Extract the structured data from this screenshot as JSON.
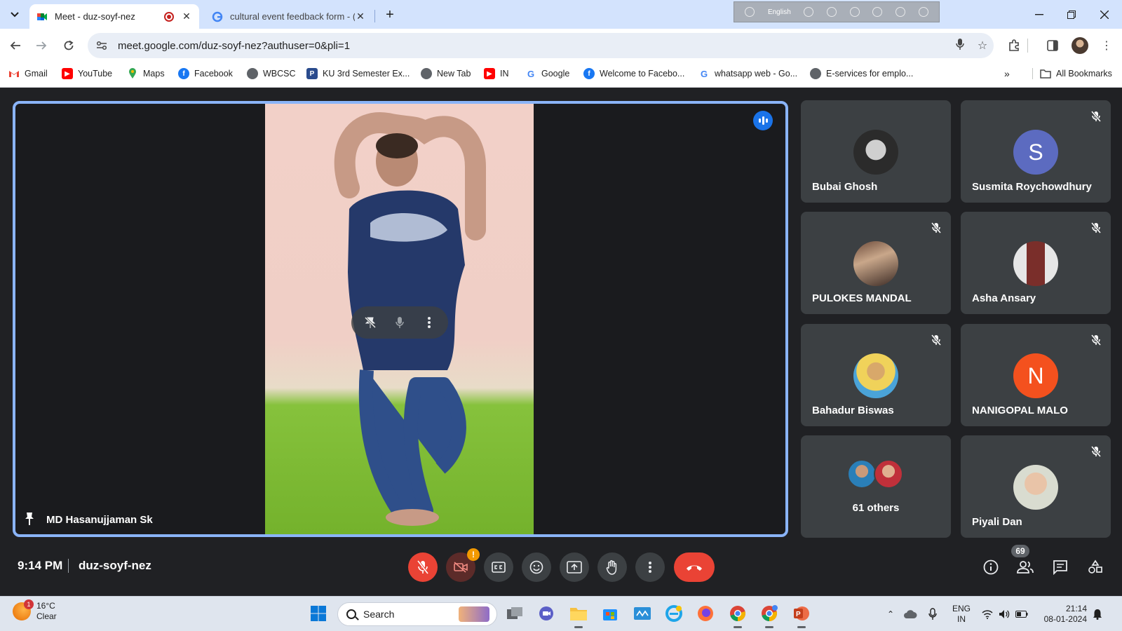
{
  "browser": {
    "tabs": [
      {
        "title": "Meet - duz-soyf-nez",
        "active": true,
        "favicon": "meet-icon",
        "recording": true
      },
      {
        "title": "cultural event feedback form - (",
        "active": false,
        "favicon": "google-icon"
      }
    ],
    "url": "meet.google.com/duz-soyf-nez?authuser=0&pli=1",
    "ime_language": "English",
    "bookmarks": [
      {
        "label": "Gmail",
        "icon": "gmail-icon"
      },
      {
        "label": "YouTube",
        "icon": "youtube-icon"
      },
      {
        "label": "Maps",
        "icon": "maps-icon"
      },
      {
        "label": "Facebook",
        "icon": "facebook-icon"
      },
      {
        "label": "WBCSC",
        "icon": "globe-icon"
      },
      {
        "label": "KU 3rd Semester Ex...",
        "icon": "ku-icon"
      },
      {
        "label": "New Tab",
        "icon": "globe-icon"
      },
      {
        "label": "IN",
        "icon": "youtube-icon"
      },
      {
        "label": "Google",
        "icon": "google-icon"
      },
      {
        "label": "Welcome to Facebo...",
        "icon": "facebook-icon"
      },
      {
        "label": "whatsapp web - Go...",
        "icon": "google-icon"
      },
      {
        "label": "E-services for emplo...",
        "icon": "globe-icon"
      }
    ],
    "all_bookmarks_label": "All Bookmarks"
  },
  "meet": {
    "main_speaker": "MD Hasanujjaman Sk",
    "participants": [
      {
        "name": "Bubai Ghosh",
        "muted": false,
        "avatar": "photo"
      },
      {
        "name": "Susmita Roychowdhury",
        "muted": true,
        "avatar": "letter",
        "letter": "S",
        "color": "#5c6bc0"
      },
      {
        "name": "PULOKES MANDAL",
        "muted": true,
        "avatar": "photo"
      },
      {
        "name": "Asha Ansary",
        "muted": true,
        "avatar": "photo"
      },
      {
        "name": "Bahadur Biswas",
        "muted": true,
        "avatar": "photo"
      },
      {
        "name": "NANIGOPAL MALO",
        "muted": true,
        "avatar": "letter",
        "letter": "N",
        "color": "#f4511e"
      },
      {
        "name": "61 others",
        "muted": false,
        "avatar": "group"
      },
      {
        "name": "Piyali Dan",
        "muted": true,
        "avatar": "photo"
      }
    ],
    "time": "9:14 PM",
    "meeting_code": "duz-soyf-nez",
    "people_count": "69",
    "camera_warning": "!"
  },
  "taskbar": {
    "weather_temp": "16°C",
    "weather_desc": "Clear",
    "weather_badge": "1",
    "search_placeholder": "Search",
    "lang_top": "ENG",
    "lang_bottom": "IN",
    "clock_time": "21:14",
    "clock_date": "08-01-2024"
  },
  "colors": {
    "accent": "#8ab4f8",
    "end_call": "#ea4335",
    "tile_bg": "#3c4043",
    "stage_bg": "#202124"
  }
}
